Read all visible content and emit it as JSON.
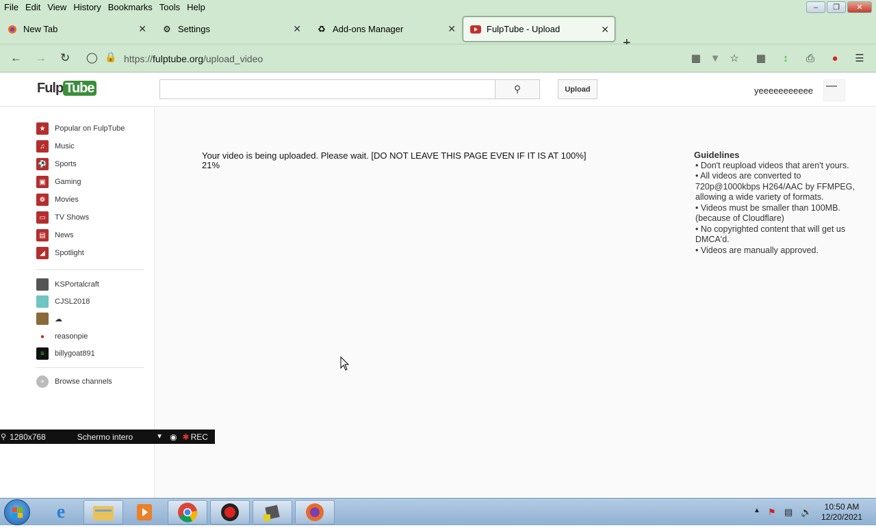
{
  "menu": [
    "File",
    "Edit",
    "View",
    "History",
    "Bookmarks",
    "Tools",
    "Help"
  ],
  "tabs": [
    {
      "label": "New Tab",
      "icon": "firefox-icon"
    },
    {
      "label": "Settings",
      "icon": "gear-icon"
    },
    {
      "label": "Add-ons Manager",
      "icon": "puzzle-icon"
    },
    {
      "label": "FulpTube - Upload",
      "icon": "fulptube-favicon"
    }
  ],
  "url": {
    "prefix": "https://",
    "host": "fulptube.org",
    "path": "/upload_video"
  },
  "site": {
    "logo_a": "Fulp",
    "logo_b": "Tube",
    "search_value": "",
    "upload_label": "Upload",
    "username": "yeeeeeeeeeee"
  },
  "sidebar": {
    "categories": [
      "Popular on FulpTube",
      "Music",
      "Sports",
      "Gaming",
      "Movies",
      "TV Shows",
      "News",
      "Spotlight"
    ],
    "subscriptions": [
      "KSPortalcraft",
      "CJSL2018",
      "☁",
      "reasonpie",
      "billygoat891"
    ],
    "browse": "Browse channels"
  },
  "upload_status": {
    "message": "Your video is being uploaded. Please wait. [DO NOT LEAVE THIS PAGE EVEN IF IT IS AT 100%]",
    "progress": "21%"
  },
  "guidelines": {
    "title": "Guidelines",
    "items": [
      "Don't reupload videos that aren't yours.",
      "All videos are converted to 720p@1000kbps H264/AAC by FFMPEG, allowing a wide variety of formats.",
      "Videos must be smaller than 100MB. (because of Cloudflare)",
      "No copyrighted content that will get us DMCA'd.",
      "Videos are manually approved."
    ]
  },
  "recorder": {
    "resolution": "1280x768",
    "mode": "Schermo intero",
    "rec": "REC"
  },
  "taskbar": {
    "time": "10:50 AM",
    "date": "12/20/2021"
  },
  "colors": {
    "chrome_green": "#cfe8cf",
    "brand_red": "#b52e2e",
    "brand_green": "#3a8f3a"
  }
}
